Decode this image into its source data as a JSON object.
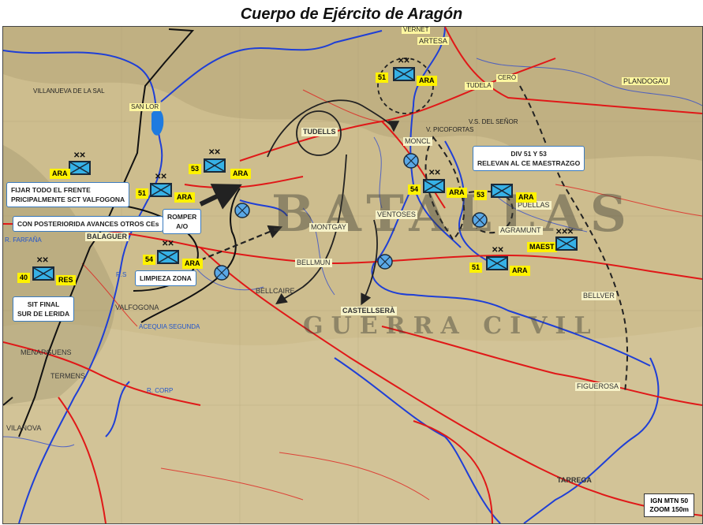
{
  "title": "Cuerpo de Ejército de Aragón",
  "watermark": {
    "big": "BATALLAS",
    "small": "GUERRA CIVIL"
  },
  "callouts": {
    "fijar_1": "FIJAR TODO EL FRENTE",
    "fijar_2": "PRICIPALMENTE SCT VALFOGONA",
    "posterior": "CON POSTERIORIDA AVANCES OTROS CEs",
    "romper_1": "ROMPER",
    "romper_2": "A/O",
    "limpieza": "LIMPIEZA ZONA",
    "sit_1": "SIT FINAL",
    "sit_2": "SUR DE LERIDA",
    "div_1": "DIV 51 Y 53",
    "div_2": "RELEVAN AL CE MAESTRAZGO"
  },
  "units": {
    "u_ara_a": {
      "label": "ARA"
    },
    "u_51_b": {
      "num": "51",
      "label": "ARA"
    },
    "u_53_c": {
      "num": "53"
    },
    "u_54_d": {
      "num": "54",
      "label": "ARA"
    },
    "u_40_e": {
      "num": "40",
      "label": "RES"
    },
    "u_51_f": {
      "num": "51",
      "label": "ARA"
    },
    "u_54_g": {
      "num": "54",
      "label": "ARA"
    },
    "u_53_h": {
      "num": "53",
      "label": "ARA"
    },
    "u_maest": {
      "num": "MAEST"
    },
    "u_51_i": {
      "num": "51",
      "label": "ARA"
    },
    "ara_c2": "ARA"
  },
  "places": {
    "artesa": "ARTESA",
    "vernet": "VERNET",
    "tudela": "TUDELA",
    "cero": "CERÓ",
    "plandogau": "PLANDOGAU",
    "tudells": "TUDELLS",
    "moncl": "MONCL",
    "ventoses": "VENTOSES",
    "montgay": "MONTGAY",
    "bellmun": "BELLMUN",
    "bellcaire": "BELLCAIRE",
    "castellsera": "CASTELLSERÀ",
    "balaguer": "BALAGUER",
    "valfogona": "VALFOGONA",
    "agramunt": "AGRAMUNT",
    "puellas": "PUELLAS",
    "bellver": "BELLVER",
    "figuerosa": "FIGUEROSA",
    "tarrega": "TARREGA",
    "san_lorenzo": "SAN LOR",
    "villanueva": "VILLANUEVA DE LA SAL",
    "menarguens": "MENARGUENS",
    "termens": "TERMENS",
    "vilanova": "VILANOVA",
    "picofortas": "V. PICOFORTAS",
    "s_senor": "V.S. DEL SEÑOR"
  },
  "rivers": {
    "farfana": "R. FARFAÑA",
    "corp": "R. CORP",
    "acequia": "ACEQUIA SEGUNDA",
    "rs": "R.S"
  },
  "ign": {
    "line1": "IGN MTN 50",
    "line2": "ZOOM 150m"
  },
  "colors": {
    "unit_fill": "#36b1e6",
    "highlight": "#fff200",
    "road": "#e01818",
    "river": "#1f3fd6",
    "terrain": "#cdbd8e"
  }
}
